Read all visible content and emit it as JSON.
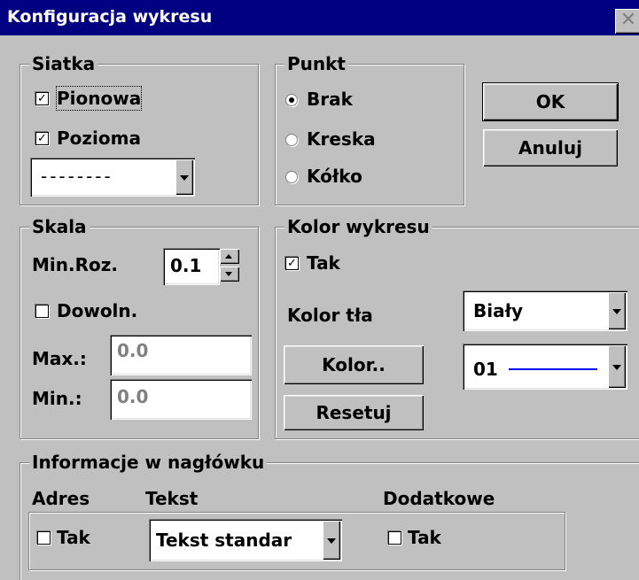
{
  "window": {
    "title": "Konfiguracja wykresu",
    "close_glyph": "✕"
  },
  "grid": {
    "legend": "Siatka",
    "vertical": {
      "label": "Pionowa",
      "checked": true
    },
    "horizontal": {
      "label": "Pozioma",
      "checked": true
    },
    "line_style": "--------"
  },
  "point": {
    "legend": "Punkt",
    "options": [
      "Brak",
      "Kreska",
      "Kółko"
    ],
    "selected": "Brak"
  },
  "buttons": {
    "ok": "OK",
    "cancel": "Anuluj",
    "color": "Kolor..",
    "reset": "Resetuj"
  },
  "scale": {
    "legend": "Skala",
    "min_div_label": "Min.Roz.",
    "min_div_value": "0.1",
    "arbitrary": {
      "label": "Dowoln.",
      "checked": false
    },
    "max_label": "Max.:",
    "max_value": "0.0",
    "min_label": "Min.:",
    "min_value": "0.0"
  },
  "chart_color": {
    "legend": "Kolor wykresu",
    "enabled": {
      "label": "Tak",
      "checked": true
    },
    "background_label": "Kolor tła",
    "background_value": "Biały",
    "line_value": "01",
    "line_color": "#0000ff"
  },
  "header_info": {
    "legend": "Informacje w nagłówku",
    "col_address": "Adres",
    "col_text": "Tekst",
    "col_extra": "Dodatkowe",
    "address": {
      "label": "Tak",
      "checked": false
    },
    "text_value": "Tekst standar",
    "extra": {
      "label": "Tak",
      "checked": false
    }
  }
}
